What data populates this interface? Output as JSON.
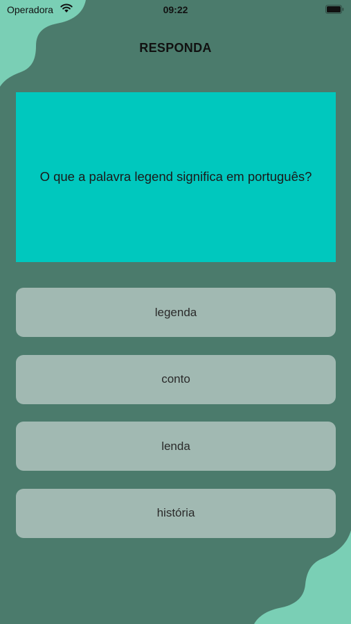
{
  "status_bar": {
    "carrier": "Operadora",
    "time": "09:22",
    "wifi_icon": "wifi-icon",
    "battery_icon": "battery-full-icon"
  },
  "header": {
    "title": "RESPONDA"
  },
  "question": {
    "text": "O que a palavra legend significa em português?"
  },
  "answers": [
    {
      "label": "legenda"
    },
    {
      "label": "conto"
    },
    {
      "label": "lenda"
    },
    {
      "label": "história"
    }
  ],
  "colors": {
    "background": "#4b7b6c",
    "decor_blob": "#7acfb5",
    "question_card": "#00c8be",
    "answer_button": "#a1b9b2",
    "text": "#111111"
  }
}
